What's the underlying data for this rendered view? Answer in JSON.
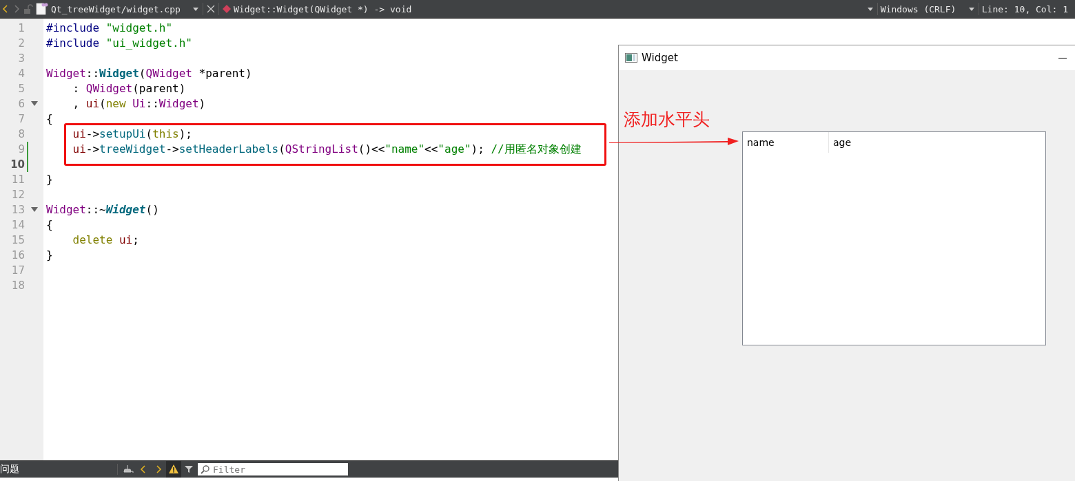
{
  "toolbar": {
    "back": {
      "disabled": false
    },
    "forward": {
      "disabled": true
    },
    "file_name": "Qt_treeWidget/widget.cpp",
    "symbol": "Widget::Widget(QWidget *) -> void",
    "line_endings": "Windows (CRLF)",
    "position": "Line: 10, Col: 1"
  },
  "editor": {
    "lines": [
      {
        "number": "1",
        "current": false,
        "modified": false,
        "foldable": false,
        "tokens": [
          {
            "kind": "directive",
            "text": "#include "
          },
          {
            "kind": "string",
            "text": "\"widget.h\""
          }
        ]
      },
      {
        "number": "2",
        "current": false,
        "modified": false,
        "foldable": false,
        "tokens": [
          {
            "kind": "directive",
            "text": "#include "
          },
          {
            "kind": "string",
            "text": "\"ui_widget.h\""
          }
        ]
      },
      {
        "number": "3",
        "current": false,
        "modified": false,
        "foldable": false
      },
      {
        "number": "4",
        "current": false,
        "modified": false,
        "foldable": false,
        "tokens": [
          {
            "kind": "type",
            "text": "Widget"
          },
          {
            "kind": "plain",
            "text": "::"
          },
          {
            "kind": "definition",
            "text": "Widget"
          },
          {
            "kind": "plain",
            "text": "("
          },
          {
            "kind": "type",
            "text": "QWidget"
          },
          {
            "kind": "plain",
            "text": " *parent)"
          }
        ]
      },
      {
        "number": "5",
        "current": false,
        "modified": false,
        "foldable": false,
        "tokens": [
          {
            "kind": "plain",
            "text": "    : "
          },
          {
            "kind": "type",
            "text": "QWidget"
          },
          {
            "kind": "plain",
            "text": "(parent)"
          }
        ]
      },
      {
        "number": "6",
        "current": false,
        "modified": false,
        "foldable": true,
        "tokens": [
          {
            "kind": "plain",
            "text": "    , "
          },
          {
            "kind": "member",
            "text": "ui"
          },
          {
            "kind": "plain",
            "text": "("
          },
          {
            "kind": "keyword",
            "text": "new "
          },
          {
            "kind": "type",
            "text": "Ui"
          },
          {
            "kind": "plain",
            "text": "::"
          },
          {
            "kind": "type",
            "text": "Widget"
          },
          {
            "kind": "plain",
            "text": ")"
          }
        ]
      },
      {
        "number": "7",
        "current": false,
        "modified": false,
        "foldable": false,
        "tokens": [
          {
            "kind": "plain",
            "text": "{"
          }
        ]
      },
      {
        "number": "8",
        "current": false,
        "modified": false,
        "foldable": false,
        "indented": true,
        "tokens": [
          {
            "kind": "member",
            "text": "ui"
          },
          {
            "kind": "plain",
            "text": "->"
          },
          {
            "kind": "function",
            "text": "setupUi"
          },
          {
            "kind": "plain",
            "text": "("
          },
          {
            "kind": "keyword",
            "text": "this"
          },
          {
            "kind": "plain",
            "text": ");"
          }
        ]
      },
      {
        "number": "9",
        "current": false,
        "modified": true,
        "foldable": false,
        "indented": true,
        "tokens": [
          {
            "kind": "member",
            "text": "ui"
          },
          {
            "kind": "plain",
            "text": "->"
          },
          {
            "kind": "function",
            "text": "treeWidget"
          },
          {
            "kind": "plain",
            "text": "->"
          },
          {
            "kind": "function",
            "text": "setHeaderLabels"
          },
          {
            "kind": "plain",
            "text": "("
          },
          {
            "kind": "type",
            "text": "QStringList"
          },
          {
            "kind": "plain",
            "text": "()<<"
          },
          {
            "kind": "string",
            "text": "\"name\""
          },
          {
            "kind": "plain",
            "text": "<<"
          },
          {
            "kind": "string",
            "text": "\"age\""
          },
          {
            "kind": "plain",
            "text": "); "
          },
          {
            "kind": "comment",
            "text": "//用匿名对象创建"
          }
        ]
      },
      {
        "number": "10",
        "current": true,
        "modified": true,
        "foldable": false
      },
      {
        "number": "11",
        "current": false,
        "modified": false,
        "foldable": false,
        "tokens": [
          {
            "kind": "plain",
            "text": "}"
          }
        ]
      },
      {
        "number": "12",
        "current": false,
        "modified": false,
        "foldable": false
      },
      {
        "number": "13",
        "current": false,
        "modified": false,
        "foldable": true,
        "tokens": [
          {
            "kind": "type",
            "text": "Widget"
          },
          {
            "kind": "plain",
            "text": "::~"
          },
          {
            "kind": "destructor",
            "text": "Widget"
          },
          {
            "kind": "plain",
            "text": "()"
          }
        ]
      },
      {
        "number": "14",
        "current": false,
        "modified": false,
        "foldable": false,
        "tokens": [
          {
            "kind": "plain",
            "text": "{"
          }
        ]
      },
      {
        "number": "15",
        "current": false,
        "modified": false,
        "foldable": false,
        "indented": true,
        "tokens": [
          {
            "kind": "keyword",
            "text": "delete "
          },
          {
            "kind": "member",
            "text": "ui"
          },
          {
            "kind": "plain",
            "text": ";"
          }
        ]
      },
      {
        "number": "16",
        "current": false,
        "modified": false,
        "foldable": false,
        "tokens": [
          {
            "kind": "plain",
            "text": "}"
          }
        ]
      },
      {
        "number": "17",
        "current": false,
        "modified": false,
        "foldable": false
      },
      {
        "number": "18",
        "current": false,
        "modified": false,
        "foldable": false
      }
    ]
  },
  "annotation": {
    "text": "添加水平头"
  },
  "output_pane": {
    "title": "问题",
    "tools": [
      {
        "kind": "clear",
        "selected": false
      },
      {
        "kind": "previous",
        "selected": false
      },
      {
        "kind": "next",
        "selected": false
      },
      {
        "kind": "warning",
        "selected": true
      },
      {
        "kind": "filter",
        "selected": false
      }
    ],
    "filter": {
      "placeholder": "Filter"
    }
  },
  "widget_window": {
    "title": "Widget",
    "tree": {
      "columns": [
        "name",
        "age"
      ]
    }
  }
}
